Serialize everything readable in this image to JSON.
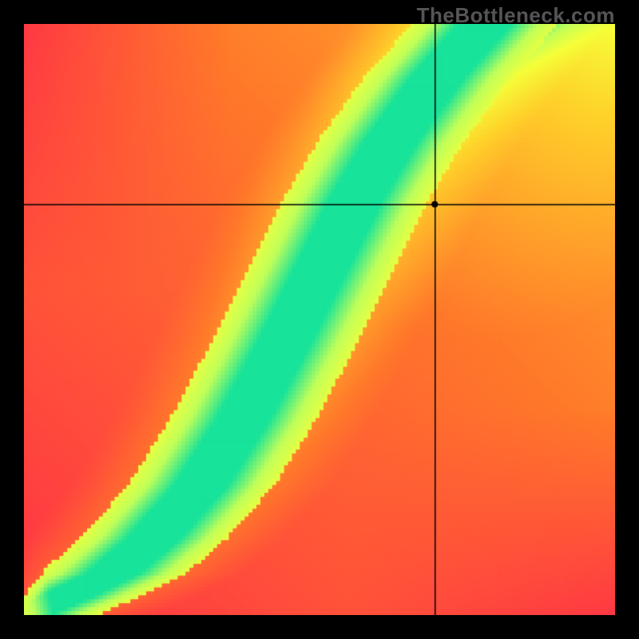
{
  "watermark": "TheBottleneck.com",
  "chart_data": {
    "type": "heatmap",
    "title": "",
    "xlabel": "",
    "ylabel": "",
    "xlim": [
      0,
      1
    ],
    "ylim": [
      0,
      1
    ],
    "grid": false,
    "legend": false,
    "color_stops": [
      {
        "t": 0.0,
        "hex": "#ff2b4a"
      },
      {
        "t": 0.4,
        "hex": "#ff7a2a"
      },
      {
        "t": 0.72,
        "hex": "#ffd22a"
      },
      {
        "t": 0.86,
        "hex": "#f6ff3a"
      },
      {
        "t": 0.93,
        "hex": "#c0ff5a"
      },
      {
        "t": 1.0,
        "hex": "#18e39a"
      }
    ],
    "ridge": {
      "points": [
        {
          "x": 0.0,
          "y": 0.0
        },
        {
          "x": 0.07,
          "y": 0.03
        },
        {
          "x": 0.15,
          "y": 0.07
        },
        {
          "x": 0.22,
          "y": 0.13
        },
        {
          "x": 0.3,
          "y": 0.22
        },
        {
          "x": 0.37,
          "y": 0.33
        },
        {
          "x": 0.44,
          "y": 0.46
        },
        {
          "x": 0.5,
          "y": 0.58
        },
        {
          "x": 0.56,
          "y": 0.7
        },
        {
          "x": 0.62,
          "y": 0.8
        },
        {
          "x": 0.7,
          "y": 0.91
        },
        {
          "x": 0.78,
          "y": 1.0
        }
      ],
      "width": 0.045,
      "soft_falloff": 0.18
    },
    "secondary_gradient": {
      "origin": {
        "x": 1.0,
        "y": 1.0
      },
      "peak_value": 0.86,
      "radius": 1.35
    },
    "crosshair": {
      "x": 0.695,
      "y": 0.695,
      "dot_radius_px": 4,
      "line_color": "#000000"
    },
    "resolution": 150
  }
}
